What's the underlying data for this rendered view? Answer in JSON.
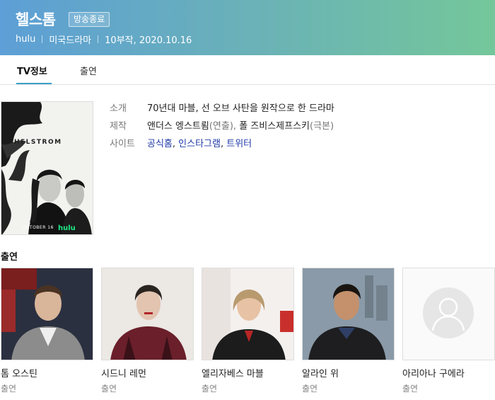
{
  "header": {
    "title": "헬스톰",
    "status_badge": "방송종료",
    "network": "hulu",
    "genre": "미국드라마",
    "episodes_date": "10부작, 2020.10.16"
  },
  "tabs": [
    {
      "label": "TV정보",
      "active": true
    },
    {
      "label": "출연",
      "active": false
    }
  ],
  "poster": {
    "title_text": "HELSTROM",
    "date_text": "OCTOBER 16",
    "logo_text": "hulu"
  },
  "info": {
    "intro_label": "소개",
    "intro_value": "70년대 마블, 선 오브 사탄을 원작으로 한 드라마",
    "production_label": "제작",
    "director": "앤더스 엥스트룀",
    "director_role": "(연출),",
    "writer": "폴 즈비스제프스키",
    "writer_role": "(극본)",
    "site_label": "사이트",
    "sites": [
      "공식홈",
      "인스타그램",
      "트위터"
    ],
    "site_separator": ","
  },
  "cast_section_title": "출연",
  "cast": [
    {
      "name": "톰 오스틴",
      "role": "출연"
    },
    {
      "name": "시드니 레먼",
      "role": "출연"
    },
    {
      "name": "엘리자베스 마블",
      "role": "출연"
    },
    {
      "name": "알라인 위",
      "role": "출연"
    },
    {
      "name": "아리아나 구에라",
      "role": "출연"
    }
  ],
  "colors": {
    "banner_start": "#5d9fd6",
    "banner_end": "#74c79a",
    "tab_indicator": "#3b9fc9",
    "link": "#1e39a8",
    "hulu_green": "#1ce783"
  }
}
